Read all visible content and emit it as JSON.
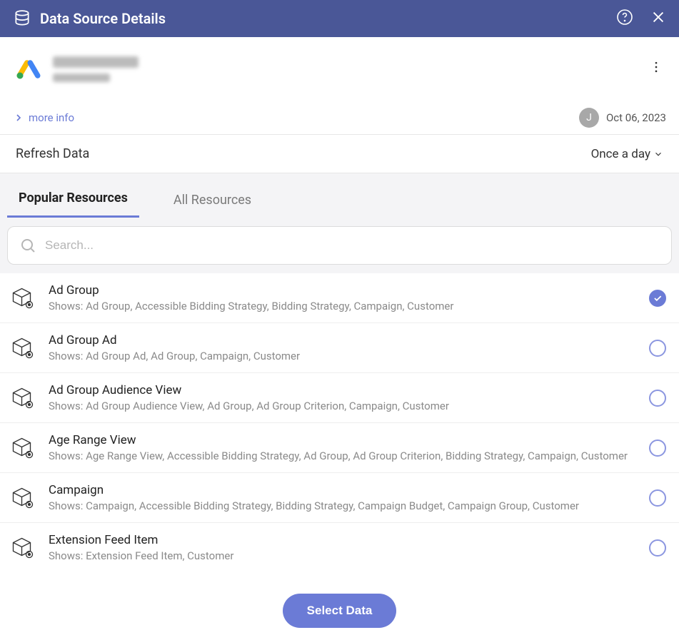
{
  "titlebar": {
    "title": "Data Source Details"
  },
  "source": {
    "name": "(redacted)",
    "subtitle": "(redacted)"
  },
  "meta": {
    "more_info_label": "more info",
    "avatar_initial": "J",
    "date": "Oct 06, 2023"
  },
  "refresh": {
    "label": "Refresh Data",
    "frequency": "Once a day"
  },
  "tabs": {
    "popular": "Popular Resources",
    "all": "All Resources",
    "active": "popular"
  },
  "search": {
    "placeholder": "Search..."
  },
  "resources": [
    {
      "name": "Ad Group",
      "shows": "Shows: Ad Group, Accessible Bidding Strategy, Bidding Strategy, Campaign, Customer",
      "selected": true
    },
    {
      "name": "Ad Group Ad",
      "shows": "Shows: Ad Group Ad, Ad Group, Campaign, Customer",
      "selected": false
    },
    {
      "name": "Ad Group Audience View",
      "shows": "Shows: Ad Group Audience View, Ad Group, Ad Group Criterion, Campaign, Customer",
      "selected": false
    },
    {
      "name": "Age Range View",
      "shows": "Shows: Age Range View, Accessible Bidding Strategy, Ad Group, Ad Group Criterion, Bidding Strategy, Campaign, Customer",
      "selected": false
    },
    {
      "name": "Campaign",
      "shows": "Shows: Campaign, Accessible Bidding Strategy, Bidding Strategy, Campaign Budget, Campaign Group, Customer",
      "selected": false
    },
    {
      "name": "Extension Feed Item",
      "shows": "Shows: Extension Feed Item, Customer",
      "selected": false
    }
  ],
  "footer": {
    "select_label": "Select Data"
  }
}
